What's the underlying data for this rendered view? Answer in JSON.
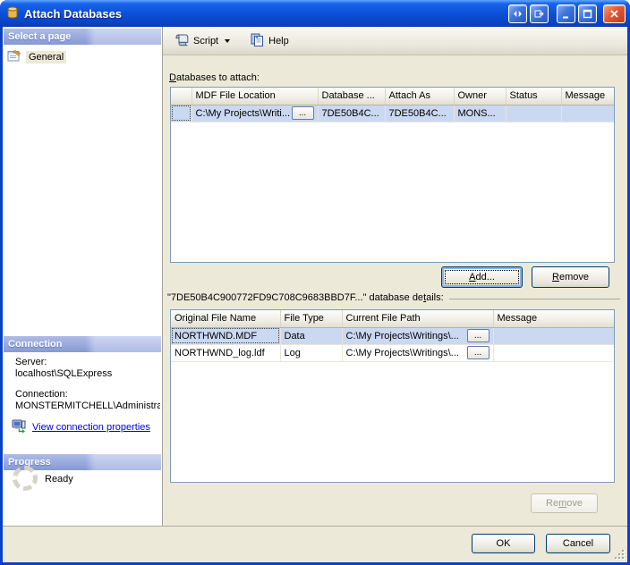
{
  "colors": {
    "titlebar-1": "#5ea4ff",
    "titlebar-2": "#1863ea",
    "titlebar-3": "#0c50d8",
    "titlebar-4": "#0843c2",
    "titlebar-5": "#0b3cab",
    "window-border": "#0a40c4",
    "dialog-bg": "#ece9d8",
    "divider": "#a5a295",
    "panel-header-left": "#8c9fdc",
    "panel-header-right": "#b6c3ed",
    "selection": "#cbd8f2",
    "grid-border": "#7f9db9",
    "link": "#0000ee",
    "button-border": "#003c74",
    "focus-ring": "#8cb4e2",
    "disabled-text": "#9e9c92",
    "close-1": "#f2a379",
    "close-2": "#e05a30",
    "close-3": "#c03d1c",
    "spinner": "#d6d3c9"
  },
  "icons": {
    "titlebar": [
      "database",
      "switch-panes",
      "undock",
      "minimize",
      "maximize",
      "close"
    ],
    "toolbar": [
      "script-scroll",
      "chevron-down",
      "help-pages"
    ],
    "sidebar": [
      "general-page",
      "connection-computer",
      "progress-spinner"
    ]
  },
  "titlebar": {
    "title": "Attach Databases"
  },
  "toolbar": {
    "script_label": "Script",
    "help_label": "Help"
  },
  "sidebar": {
    "select_page_header": "Select a page",
    "general_item": "General",
    "connection_header": "Connection",
    "server_label": "Server:",
    "server_value": "localhost\\SQLExpress",
    "connection_label": "Connection:",
    "connection_value": "MONSTERMITCHELL\\Administra",
    "view_link": "View connection properties",
    "progress_header": "Progress",
    "progress_status": "Ready"
  },
  "main": {
    "attach_label": {
      "text": "Databases to attach:",
      "u": 0
    },
    "table1": {
      "headers": [
        "",
        "MDF File Location",
        "Database ...",
        "Attach As",
        "Owner",
        "Status",
        "Message"
      ],
      "row": {
        "mdf_location": "C:\\My Projects\\Writi...",
        "browse": "...",
        "database": "7DE50B4C...",
        "attach_as": "7DE50B4C...",
        "owner": "MONS...",
        "status": "",
        "message": ""
      }
    },
    "add_button": {
      "text": "Add...",
      "u": 0
    },
    "remove_button": {
      "text": "Remove",
      "u": 0
    },
    "details_caption": {
      "text": "\"7DE50B4C900772FD9C708C9683BBD7F...\" database details:",
      "u": 48
    },
    "table2": {
      "headers": [
        "Original File Name",
        "File Type",
        "Current File Path",
        "Message"
      ],
      "rows": [
        {
          "name": "NORTHWND.MDF",
          "type": "Data",
          "path": "C:\\My Projects\\Writings\\...",
          "browse": "...",
          "message": ""
        },
        {
          "name": "NORTHWND_log.ldf",
          "type": "Log",
          "path": "C:\\My Projects\\Writings\\...",
          "browse": "...",
          "message": ""
        }
      ]
    },
    "remove_details_button": {
      "text": "Remove",
      "u": 2
    }
  },
  "footer": {
    "ok": "OK",
    "cancel": "Cancel"
  }
}
